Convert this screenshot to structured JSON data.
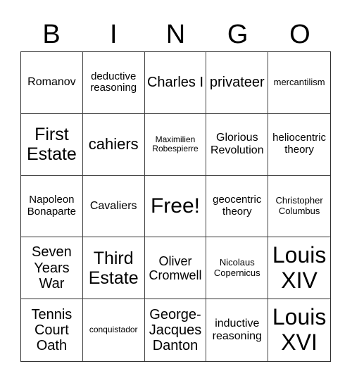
{
  "header": [
    "B",
    "I",
    "N",
    "G",
    "O"
  ],
  "cells": [
    "Romanov",
    "deductive reasoning",
    "Charles I",
    "privateer",
    "mercantilism",
    "First Estate",
    "cahiers",
    "Maximilien Robespierre",
    "Glorious Revolution",
    "heliocentric theory",
    "Napoleon Bonaparte",
    "Cavaliers",
    "Free!",
    "geocentric theory",
    "Christopher Columbus",
    "Seven Years War",
    "Third Estate",
    "Oliver Cromwell",
    "Nicolaus Copernicus",
    "Louis XIV",
    "Tennis Court Oath",
    "conquistador",
    "George-Jacques Danton",
    "inductive reasoning",
    "Louis XVI"
  ]
}
